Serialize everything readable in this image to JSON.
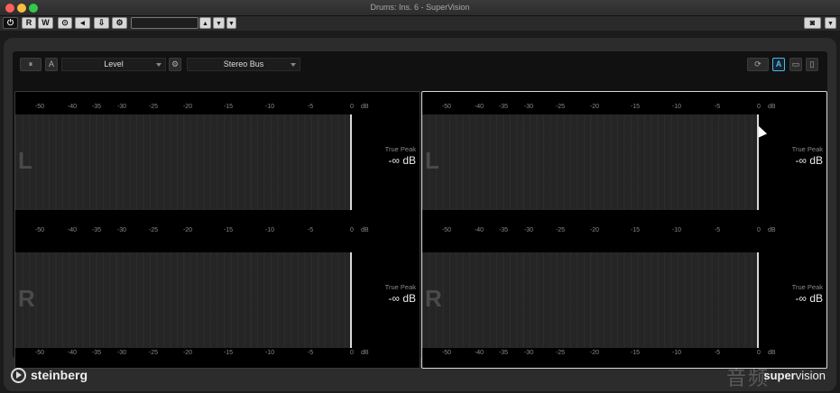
{
  "window": {
    "title": "Drums: Ins. 6 - SuperVision"
  },
  "host_toolbar": {
    "read_label": "R",
    "write_label": "W"
  },
  "plugin_toolbar": {
    "a_label": "A",
    "module_name": "Level",
    "bus_name": "Stereo Bus",
    "a_active_label": "A"
  },
  "meters": {
    "scale_ticks": [
      "-50",
      "-40",
      "-35",
      "-30",
      "-25",
      "-20",
      "-15",
      "-10",
      "-5",
      "0"
    ],
    "scale_unit": "dB",
    "panels": [
      {
        "channels": [
          {
            "letter": "L",
            "true_peak_label": "True Peak",
            "true_peak_value": "-∞ dB"
          },
          {
            "letter": "R",
            "true_peak_label": "True Peak",
            "true_peak_value": "-∞ dB"
          }
        ]
      },
      {
        "channels": [
          {
            "letter": "L",
            "true_peak_label": "True Peak",
            "true_peak_value": "-∞ dB"
          },
          {
            "letter": "R",
            "true_peak_label": "True Peak",
            "true_peak_value": "-∞ dB"
          }
        ]
      }
    ]
  },
  "footer": {
    "brand": "steinberg",
    "product_bold": "super",
    "product_light": "vision"
  },
  "watermark": "音频"
}
